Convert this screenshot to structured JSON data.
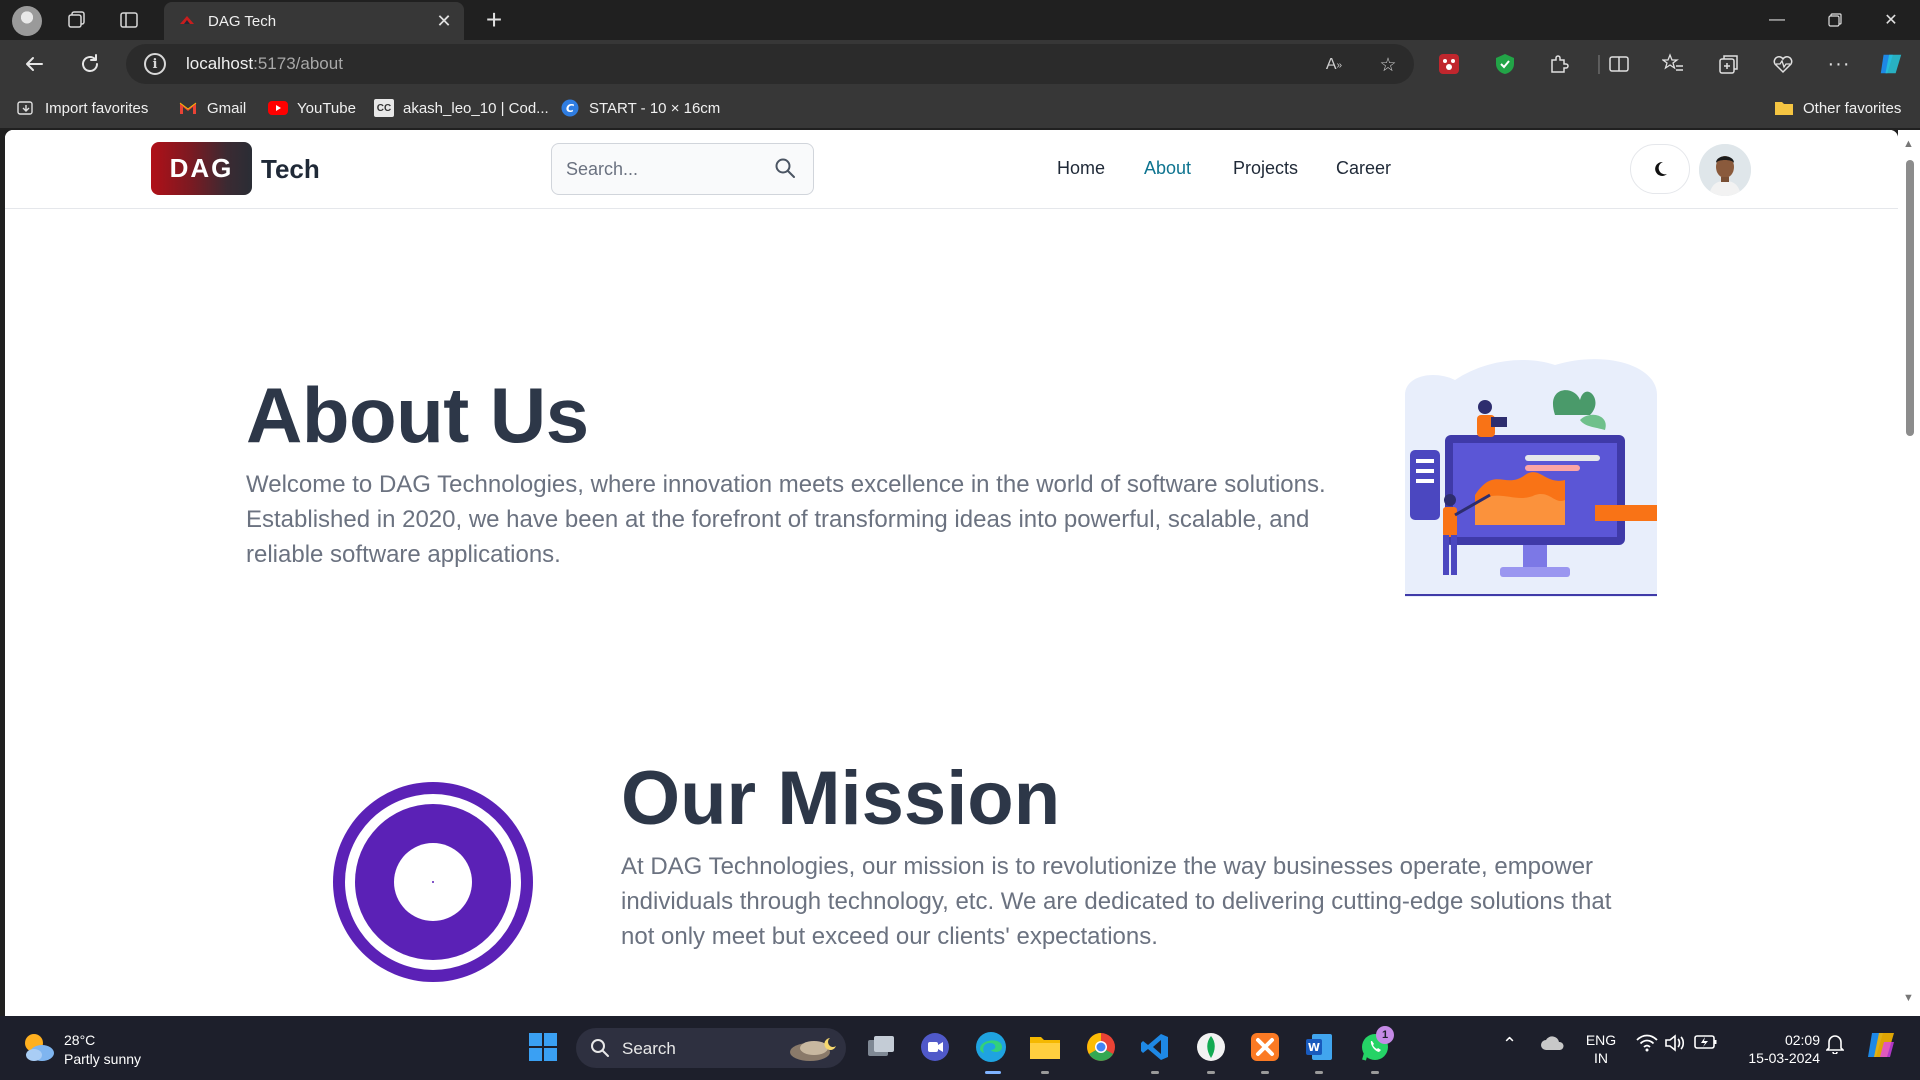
{
  "browser": {
    "tab_title": "DAG Tech",
    "url_host": "localhost",
    "url_path": ":5173/about",
    "favorites": [
      {
        "label": "Import favorites",
        "icon": "import-icon"
      },
      {
        "label": "Gmail",
        "icon": "gmail-icon"
      },
      {
        "label": "YouTube",
        "icon": "youtube-icon"
      },
      {
        "label": "akash_leo_10 | Cod...",
        "icon": "codechef-icon"
      },
      {
        "label": "START - 10 × 16cm",
        "icon": "canva-icon"
      }
    ],
    "other_favorites": "Other favorites"
  },
  "site": {
    "logo_badge": "DAG",
    "logo_text": "Tech",
    "search_placeholder": "Search...",
    "menu": [
      "Home",
      "About",
      "Projects",
      "Career"
    ],
    "active_menu": "About",
    "accent_color": "#0e7490",
    "theme_icon": "moon-icon"
  },
  "about": {
    "title": "About Us",
    "text": "Welcome to DAG Technologies, where innovation meets excellence in the world of software solutions. Established in 2020, we have been at the forefront of transforming ideas into powerful, scalable, and reliable software applications."
  },
  "mission": {
    "title": "Our Mission",
    "text": "At DAG Technologies, our mission is to revolutionize the way businesses operate, empower individuals through technology, etc. We are dedicated to delivering cutting-edge solutions that not only meet but exceed our clients' expectations.",
    "icon_color": "#5b21b6"
  },
  "taskbar": {
    "temperature": "28°C",
    "weather": "Partly sunny",
    "search_label": "Search",
    "lang_1": "ENG",
    "lang_2": "IN",
    "time": "02:09",
    "date": "15-03-2024",
    "whatsapp_badge": "1"
  }
}
